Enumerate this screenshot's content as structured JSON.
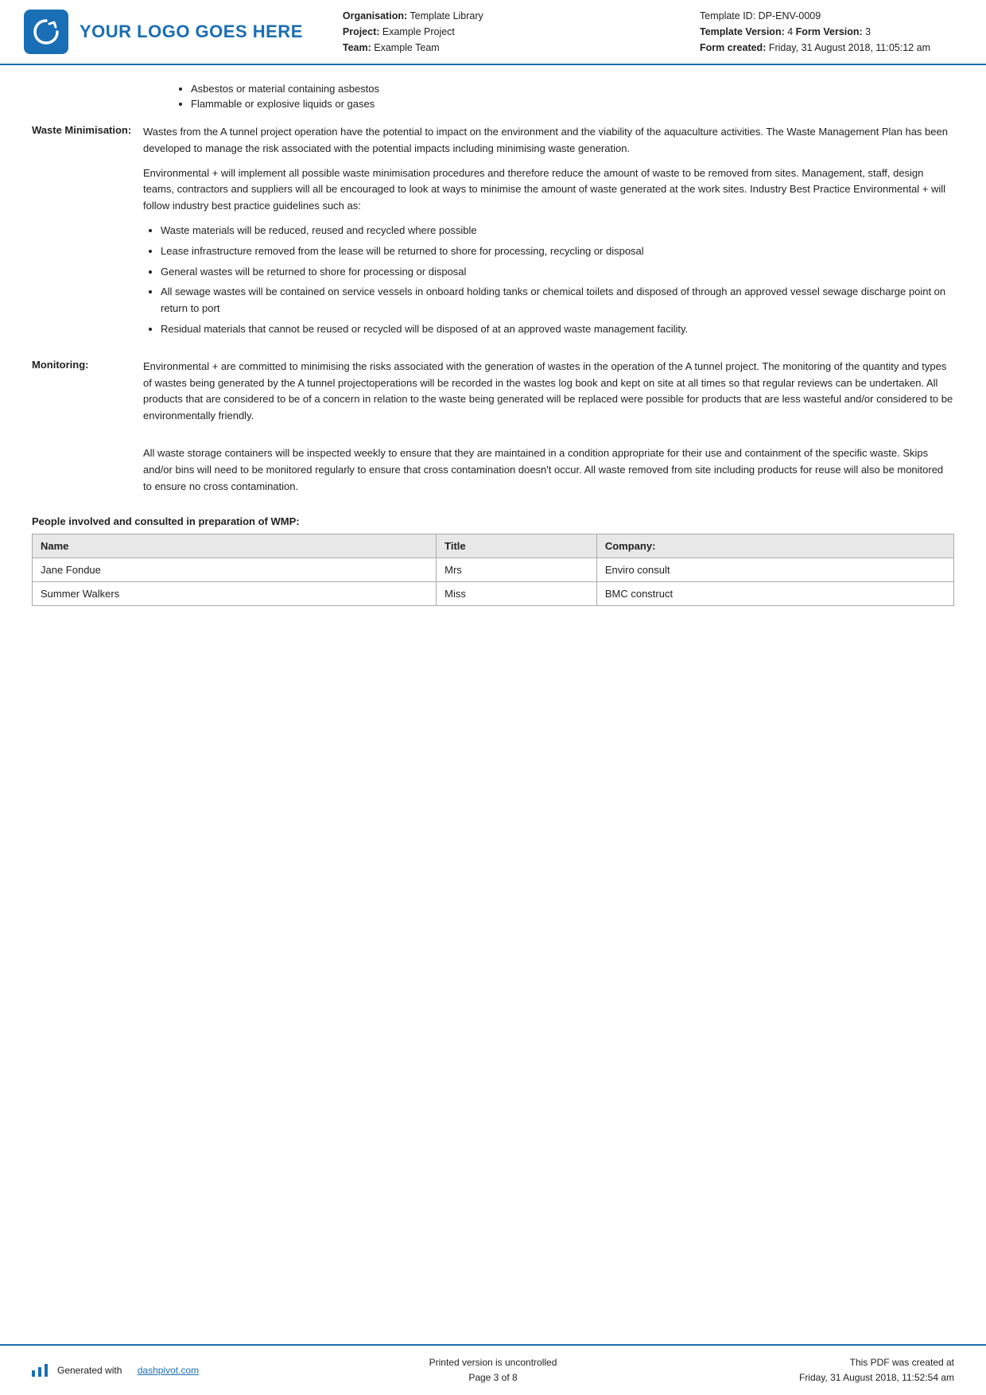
{
  "header": {
    "logo_text": "YOUR LOGO GOES HERE",
    "org_label": "Organisation:",
    "org_value": "Template Library",
    "project_label": "Project:",
    "project_value": "Example Project",
    "team_label": "Team:",
    "team_value": "Example Team",
    "template_id_label": "Template ID:",
    "template_id_value": "DP-ENV-0009",
    "template_version_label": "Template Version:",
    "template_version_value": "4",
    "form_version_label": "Form Version:",
    "form_version_value": "3",
    "form_created_label": "Form created:",
    "form_created_value": "Friday, 31 August 2018, 11:05:12 am"
  },
  "top_bullets": [
    "Asbestos or material containing asbestos",
    "Flammable or explosive liquids or gases"
  ],
  "waste_minimisation": {
    "label": "Waste Minimisation:",
    "para1": "Wastes from the A tunnel project operation have the potential to impact on the environment and the viability of the aquaculture activities. The Waste Management Plan has been developed to manage the risk associated with the potential impacts including minimising waste generation.",
    "para2": "Environmental + will implement all possible waste minimisation procedures and therefore reduce the amount of waste to be removed from sites. Management, staff, design teams, contractors and suppliers will all be encouraged to look at ways to minimise the amount of waste generated at the work sites. Industry Best Practice Environmental + will follow industry best practice guidelines such as:",
    "bullets": [
      "Waste materials will be reduced, reused and recycled where possible",
      "Lease infrastructure removed from the lease will be returned to shore for processing, recycling or disposal",
      "General wastes will be returned to shore for processing or disposal",
      "All sewage wastes will be contained on service vessels in onboard holding tanks or chemical toilets and disposed of through an approved vessel sewage discharge point on return to port",
      "Residual materials that cannot be reused or recycled will be disposed of at an approved waste management facility."
    ]
  },
  "monitoring": {
    "label": "Monitoring:",
    "para1": "Environmental + are committed to minimising the risks associated with the generation of wastes in the operation of the A tunnel project. The monitoring of the quantity and types of wastes being generated by the A tunnel projectoperations will be recorded in the wastes log book and kept on site at all times so that regular reviews can be undertaken. All products that are considered to be of a concern in relation to the waste being generated will be replaced were possible for products that are less wasteful and/or considered to be environmentally friendly.",
    "para2": "All waste storage containers will be inspected weekly to ensure that they are maintained in a condition appropriate for their use and containment of the specific waste. Skips and/or bins will need to be monitored regularly to ensure that cross contamination doesn't occur. All waste removed from site including products for reuse will also be monitored to ensure no cross contamination."
  },
  "people_section": {
    "heading": "People involved and consulted in preparation of WMP:",
    "columns": [
      "Name",
      "Title",
      "Company:"
    ],
    "rows": [
      [
        "Jane Fondue",
        "Mrs",
        "Enviro consult"
      ],
      [
        "Summer Walkers",
        "Miss",
        "BMC construct"
      ]
    ]
  },
  "footer": {
    "generated_text": "Generated with",
    "generated_link": "dashpivot.com",
    "center_line1": "Printed version is uncontrolled",
    "center_line2": "Page 3 of 8",
    "right_line1": "This PDF was created at",
    "right_line2": "Friday, 31 August 2018, 11:52:54 am"
  }
}
